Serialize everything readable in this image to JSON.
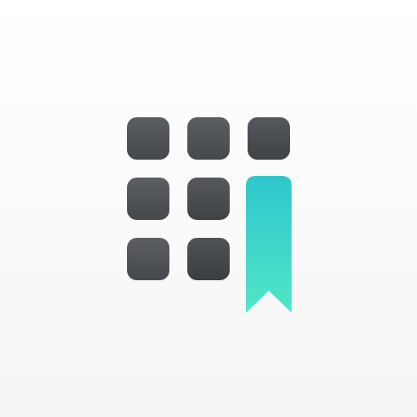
{
  "icon": {
    "name": "app-icon-grid-bookmark",
    "colors": {
      "background": "#fafafa",
      "tile_dark": "#4a4d51",
      "bookmark_top": "#2ec7cc",
      "bookmark_bottom": "#4fe6c8"
    },
    "tiles": [
      "grid-tile",
      "grid-tile",
      "grid-tile",
      "grid-tile",
      "grid-tile",
      "grid-tile",
      "grid-tile"
    ],
    "bookmark": "bookmark-icon"
  }
}
